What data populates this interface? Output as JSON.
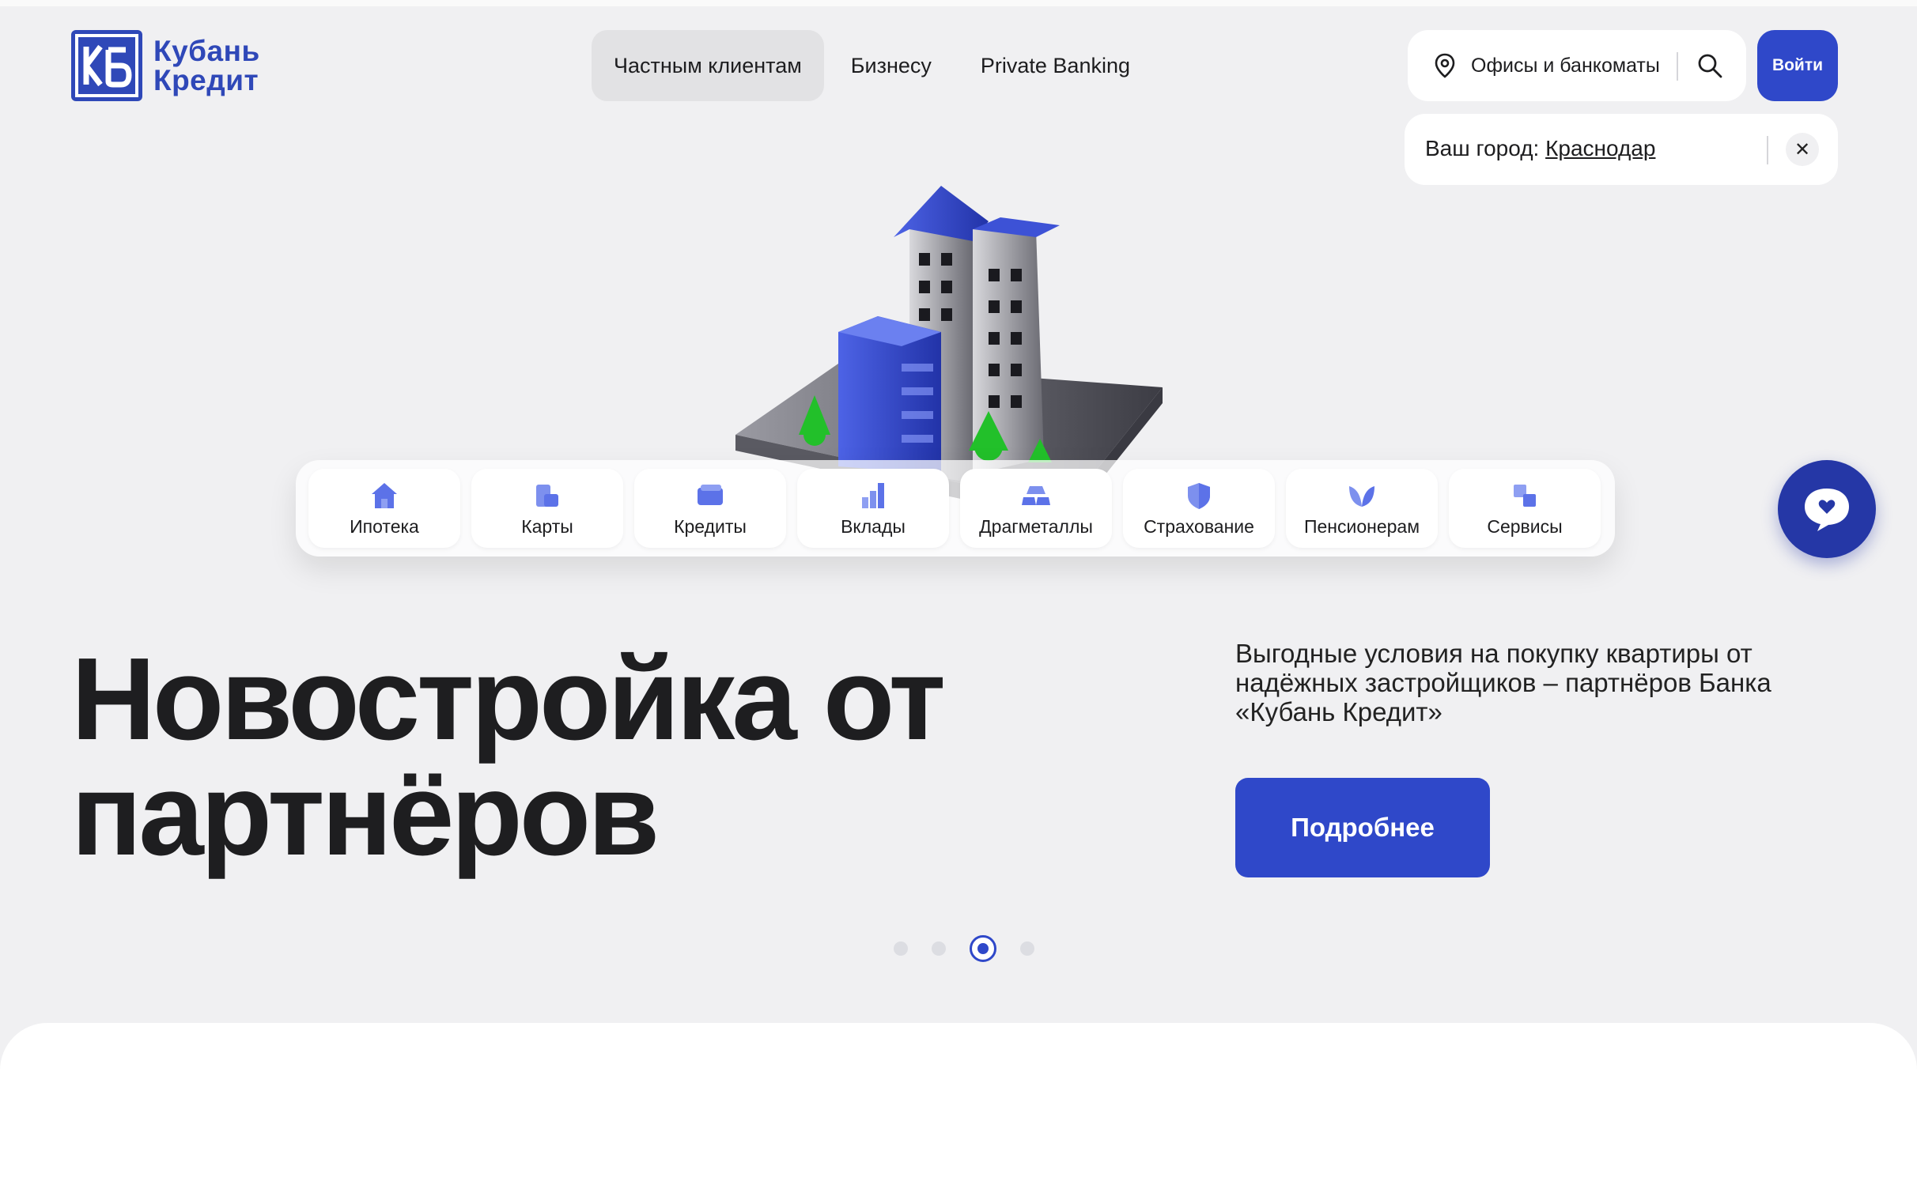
{
  "brand": {
    "line1": "Кубань",
    "line2": "Кредит",
    "color": "#2f48b8"
  },
  "nav": [
    {
      "label": "Частным клиентам",
      "active": true
    },
    {
      "label": "Бизнесу",
      "active": false
    },
    {
      "label": "Private Banking",
      "active": false
    }
  ],
  "offices": {
    "label": "Офисы и банкоматы"
  },
  "login": {
    "label": "Войти"
  },
  "city": {
    "prefix": "Ваш город: ",
    "value": "Краснодар"
  },
  "categories": [
    {
      "label": "Ипотека",
      "icon": "house-icon"
    },
    {
      "label": "Карты",
      "icon": "cards-icon"
    },
    {
      "label": "Кредиты",
      "icon": "wallet-icon"
    },
    {
      "label": "Вклады",
      "icon": "bars-icon"
    },
    {
      "label": "Драгметаллы",
      "icon": "gold-bars-icon"
    },
    {
      "label": "Страхование",
      "icon": "shield-icon"
    },
    {
      "label": "Пенсионерам",
      "icon": "leaf-icon"
    },
    {
      "label": "Сервисы",
      "icon": "squares-icon"
    }
  ],
  "hero": {
    "title_line1": "Новостройка от",
    "title_line2": "партнёров",
    "description": "Выгодные условия на покупку квартиры от надёжных застройщиков – партнёров Банка «Кубань Кредит»",
    "button": "Подробнее"
  },
  "carousel": {
    "count": 4,
    "active": 3
  },
  "colors": {
    "accent": "#2f48c9",
    "chat": "#2537a6",
    "background": "#f0f0f2"
  }
}
